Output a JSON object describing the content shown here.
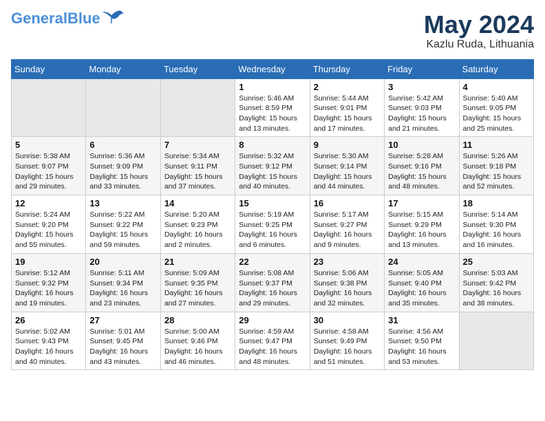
{
  "logo": {
    "line1": "General",
    "line2": "Blue"
  },
  "title": "May 2024",
  "location": "Kazlu Ruda, Lithuania",
  "days_of_week": [
    "Sunday",
    "Monday",
    "Tuesday",
    "Wednesday",
    "Thursday",
    "Friday",
    "Saturday"
  ],
  "weeks": [
    [
      {
        "day": "",
        "info": ""
      },
      {
        "day": "",
        "info": ""
      },
      {
        "day": "",
        "info": ""
      },
      {
        "day": "1",
        "info": "Sunrise: 5:46 AM\nSunset: 8:59 PM\nDaylight: 15 hours\nand 13 minutes."
      },
      {
        "day": "2",
        "info": "Sunrise: 5:44 AM\nSunset: 9:01 PM\nDaylight: 15 hours\nand 17 minutes."
      },
      {
        "day": "3",
        "info": "Sunrise: 5:42 AM\nSunset: 9:03 PM\nDaylight: 15 hours\nand 21 minutes."
      },
      {
        "day": "4",
        "info": "Sunrise: 5:40 AM\nSunset: 9:05 PM\nDaylight: 15 hours\nand 25 minutes."
      }
    ],
    [
      {
        "day": "5",
        "info": "Sunrise: 5:38 AM\nSunset: 9:07 PM\nDaylight: 15 hours\nand 29 minutes."
      },
      {
        "day": "6",
        "info": "Sunrise: 5:36 AM\nSunset: 9:09 PM\nDaylight: 15 hours\nand 33 minutes."
      },
      {
        "day": "7",
        "info": "Sunrise: 5:34 AM\nSunset: 9:11 PM\nDaylight: 15 hours\nand 37 minutes."
      },
      {
        "day": "8",
        "info": "Sunrise: 5:32 AM\nSunset: 9:12 PM\nDaylight: 15 hours\nand 40 minutes."
      },
      {
        "day": "9",
        "info": "Sunrise: 5:30 AM\nSunset: 9:14 PM\nDaylight: 15 hours\nand 44 minutes."
      },
      {
        "day": "10",
        "info": "Sunrise: 5:28 AM\nSunset: 9:16 PM\nDaylight: 15 hours\nand 48 minutes."
      },
      {
        "day": "11",
        "info": "Sunrise: 5:26 AM\nSunset: 9:18 PM\nDaylight: 15 hours\nand 52 minutes."
      }
    ],
    [
      {
        "day": "12",
        "info": "Sunrise: 5:24 AM\nSunset: 9:20 PM\nDaylight: 15 hours\nand 55 minutes."
      },
      {
        "day": "13",
        "info": "Sunrise: 5:22 AM\nSunset: 9:22 PM\nDaylight: 15 hours\nand 59 minutes."
      },
      {
        "day": "14",
        "info": "Sunrise: 5:20 AM\nSunset: 9:23 PM\nDaylight: 16 hours\nand 2 minutes."
      },
      {
        "day": "15",
        "info": "Sunrise: 5:19 AM\nSunset: 9:25 PM\nDaylight: 16 hours\nand 6 minutes."
      },
      {
        "day": "16",
        "info": "Sunrise: 5:17 AM\nSunset: 9:27 PM\nDaylight: 16 hours\nand 9 minutes."
      },
      {
        "day": "17",
        "info": "Sunrise: 5:15 AM\nSunset: 9:29 PM\nDaylight: 16 hours\nand 13 minutes."
      },
      {
        "day": "18",
        "info": "Sunrise: 5:14 AM\nSunset: 9:30 PM\nDaylight: 16 hours\nand 16 minutes."
      }
    ],
    [
      {
        "day": "19",
        "info": "Sunrise: 5:12 AM\nSunset: 9:32 PM\nDaylight: 16 hours\nand 19 minutes."
      },
      {
        "day": "20",
        "info": "Sunrise: 5:11 AM\nSunset: 9:34 PM\nDaylight: 16 hours\nand 23 minutes."
      },
      {
        "day": "21",
        "info": "Sunrise: 5:09 AM\nSunset: 9:35 PM\nDaylight: 16 hours\nand 27 minutes."
      },
      {
        "day": "22",
        "info": "Sunrise: 5:08 AM\nSunset: 9:37 PM\nDaylight: 16 hours\nand 29 minutes."
      },
      {
        "day": "23",
        "info": "Sunrise: 5:06 AM\nSunset: 9:38 PM\nDaylight: 16 hours\nand 32 minutes."
      },
      {
        "day": "24",
        "info": "Sunrise: 5:05 AM\nSunset: 9:40 PM\nDaylight: 16 hours\nand 35 minutes."
      },
      {
        "day": "25",
        "info": "Sunrise: 5:03 AM\nSunset: 9:42 PM\nDaylight: 16 hours\nand 38 minutes."
      }
    ],
    [
      {
        "day": "26",
        "info": "Sunrise: 5:02 AM\nSunset: 9:43 PM\nDaylight: 16 hours\nand 40 minutes."
      },
      {
        "day": "27",
        "info": "Sunrise: 5:01 AM\nSunset: 9:45 PM\nDaylight: 16 hours\nand 43 minutes."
      },
      {
        "day": "28",
        "info": "Sunrise: 5:00 AM\nSunset: 9:46 PM\nDaylight: 16 hours\nand 46 minutes."
      },
      {
        "day": "29",
        "info": "Sunrise: 4:59 AM\nSunset: 9:47 PM\nDaylight: 16 hours\nand 48 minutes."
      },
      {
        "day": "30",
        "info": "Sunrise: 4:58 AM\nSunset: 9:49 PM\nDaylight: 16 hours\nand 51 minutes."
      },
      {
        "day": "31",
        "info": "Sunrise: 4:56 AM\nSunset: 9:50 PM\nDaylight: 16 hours\nand 53 minutes."
      },
      {
        "day": "",
        "info": ""
      }
    ]
  ]
}
